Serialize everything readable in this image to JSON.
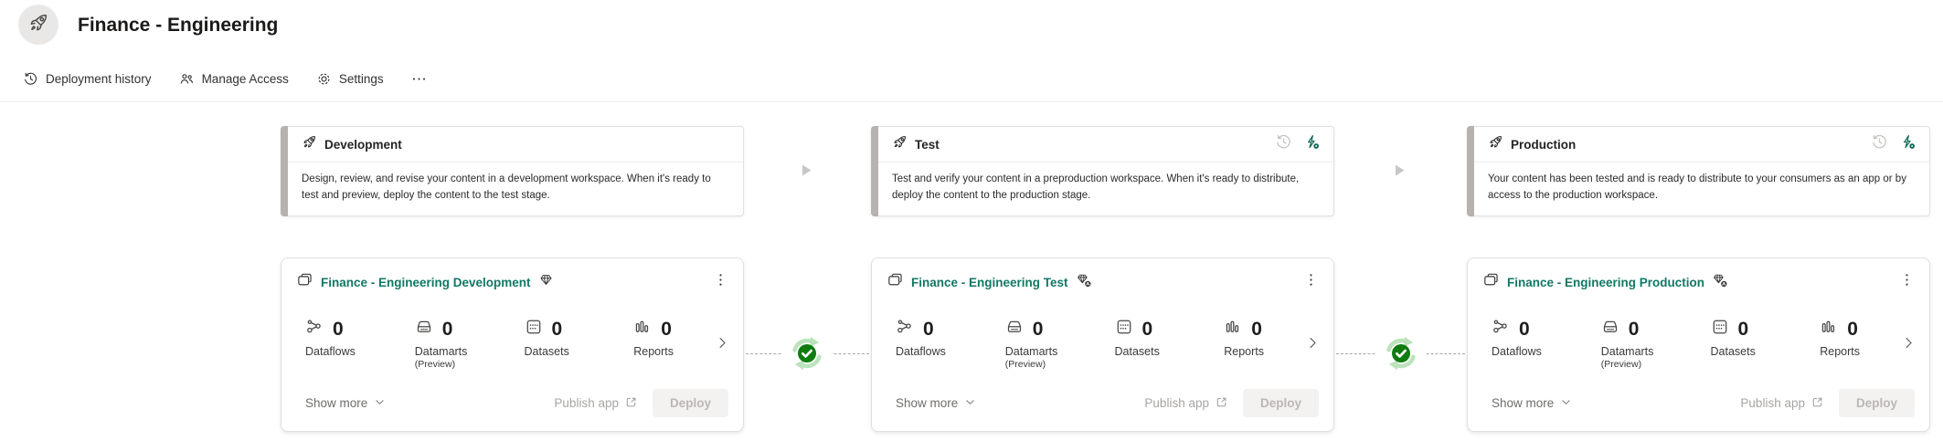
{
  "header": {
    "title": "Finance - Engineering"
  },
  "toolbar": {
    "deployment_history": "Deployment history",
    "manage_access": "Manage Access",
    "settings": "Settings",
    "more": "more"
  },
  "colors": {
    "workspace_link_teal": "#117865",
    "deploy_settings_teal": "#0e6a58",
    "success_green": "#107C10",
    "light_green_arrows": "#bce3bc",
    "stage_accent_gray": "#b7b2af"
  },
  "icons": {
    "rocket-icon": "rocket outline",
    "history-icon": "clock with restore arrow",
    "people-icon": "two persons",
    "gear-icon": "settings gear",
    "more-icon": "ellipsis",
    "workspace-icon": "stacked windows",
    "diamond-icon": "gem",
    "diamond-person-badge-icon": "gem with person badge",
    "deployment-settings-icon": "lightning with gear",
    "dataflows-icon": "linked nodes",
    "datamarts-icon": "drawer",
    "datasets-icon": "square with dots",
    "reports-icon": "bar chart",
    "chevron-right-icon": "chevron right",
    "chevron-down-icon": "chevron down",
    "kebab-icon": "vertical ellipsis",
    "external-link-icon": "open in new window",
    "sync-check-icon": "circular arrows with green check",
    "play-arrow-icon": "small gray triangle"
  },
  "stages": [
    {
      "name": "Development",
      "description": "Design, review, and revise your content in a development workspace. When it's ready to test and preview, deploy the content to the test stage.",
      "workspace": {
        "name": "Finance - Engineering Development",
        "stats": [
          {
            "label": "Dataflows",
            "value": "0"
          },
          {
            "label": "Datamarts",
            "sublabel": "(Preview)",
            "value": "0"
          },
          {
            "label": "Datasets",
            "value": "0"
          },
          {
            "label": "Reports",
            "value": "0"
          }
        ],
        "show_more": "Show more",
        "publish_app": "Publish app",
        "deploy": "Deploy"
      }
    },
    {
      "name": "Test",
      "description": "Test and verify your content in a preproduction workspace. When it's ready to distribute, deploy the content to the production stage.",
      "workspace": {
        "name": "Finance - Engineering Test",
        "stats": [
          {
            "label": "Dataflows",
            "value": "0"
          },
          {
            "label": "Datamarts",
            "sublabel": "(Preview)",
            "value": "0"
          },
          {
            "label": "Datasets",
            "value": "0"
          },
          {
            "label": "Reports",
            "value": "0"
          }
        ],
        "show_more": "Show more",
        "publish_app": "Publish app",
        "deploy": "Deploy"
      }
    },
    {
      "name": "Production",
      "description": "Your content has been tested and is ready to distribute to your consumers as an app or by access to the production workspace.",
      "workspace": {
        "name": "Finance - Engineering Production",
        "stats": [
          {
            "label": "Dataflows",
            "value": "0"
          },
          {
            "label": "Datamarts",
            "sublabel": "(Preview)",
            "value": "0"
          },
          {
            "label": "Datasets",
            "value": "0"
          },
          {
            "label": "Reports",
            "value": "0"
          }
        ],
        "show_more": "Show more",
        "publish_app": "Publish app",
        "deploy": "Deploy"
      }
    }
  ]
}
